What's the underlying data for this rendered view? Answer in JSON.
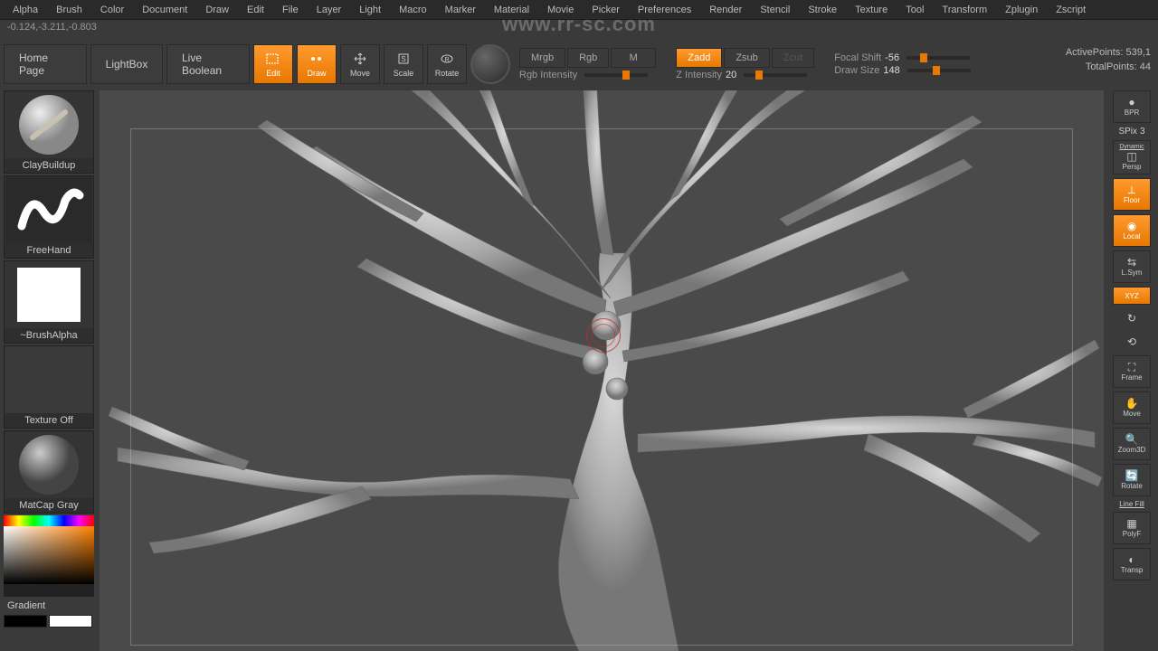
{
  "menu": [
    "Alpha",
    "Brush",
    "Color",
    "Document",
    "Draw",
    "Edit",
    "File",
    "Layer",
    "Light",
    "Macro",
    "Marker",
    "Material",
    "Movie",
    "Picker",
    "Preferences",
    "Render",
    "Stencil",
    "Stroke",
    "Texture",
    "Tool",
    "Transform",
    "Zplugin",
    "Zscript"
  ],
  "coords": "-0.124,-3.211,-0.803",
  "watermark": "www.rr-sc.com",
  "toolbar": {
    "home": "Home Page",
    "lightbox": "LightBox",
    "liveboolean": "Live Boolean",
    "edit": "Edit",
    "draw": "Draw",
    "move": "Move",
    "scale": "Scale",
    "rotate": "Rotate",
    "mrgb": "Mrgb",
    "rgb": "Rgb",
    "m": "M",
    "rgbintensity_label": "Rgb Intensity",
    "zadd": "Zadd",
    "zsub": "Zsub",
    "zcut": "Zcut",
    "zintensity_label": "Z Intensity",
    "zintensity_value": "20",
    "focalshift_label": "Focal Shift",
    "focalshift_value": "-56",
    "drawsize_label": "Draw Size",
    "drawsize_value": "148",
    "dynamic": "Dynamic"
  },
  "stats": {
    "active_label": "ActivePoints:",
    "active_value": "539,1",
    "total_label": "TotalPoints:",
    "total_value": "44"
  },
  "left": {
    "brush": "ClayBuildup",
    "stroke": "FreeHand",
    "alpha": "~BrushAlpha",
    "texture": "Texture Off",
    "material": "MatCap Gray",
    "gradient": "Gradient"
  },
  "right": {
    "bpr": "BPR",
    "spix_label": "SPix",
    "spix_value": "3",
    "dynamic": "Dynamic",
    "persp": "Persp",
    "floor": "Floor",
    "local": "Local",
    "lsym": "L.Sym",
    "xyz": "XYZ",
    "frame": "Frame",
    "move": "Move",
    "zoom3d": "Zoom3D",
    "rotate": "Rotate",
    "linefill": "Line Fill",
    "polyf": "PolyF",
    "transp": "Transp"
  }
}
